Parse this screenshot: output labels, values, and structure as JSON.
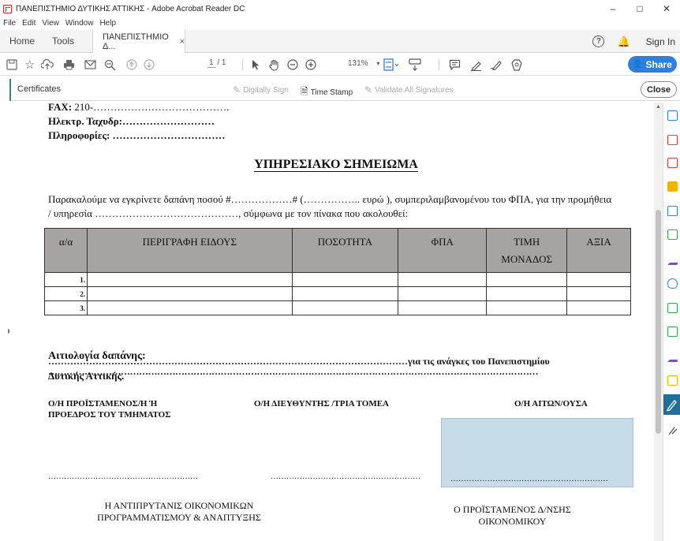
{
  "window": {
    "title": "ΠΑΝΕΠΙΣΤΗΜΙΟ ΔΥΤΙΚΗΣ ΑΤΤΙΚΗΣ - Adobe Acrobat Reader DC",
    "minimize": "–",
    "maximize": "□",
    "close": "✕"
  },
  "menu": [
    "File",
    "Edit",
    "View",
    "Window",
    "Help"
  ],
  "tabs": {
    "home": "Home",
    "tools": "Tools",
    "document": "ΠΑΝΕΠΙΣΤΗΜΙΟ Δ...",
    "document_close": "×",
    "help": "?",
    "sign_in": "Sign In"
  },
  "toolbar": {
    "page_current": "1",
    "page_total": "/ 1",
    "zoom": "131%",
    "share": "Share"
  },
  "certificates": {
    "title": "Certificates",
    "digitally_sign": "Digitally Sign",
    "time_stamp": "Time Stamp",
    "validate": "Validate All Signatures",
    "close": "Close"
  },
  "document": {
    "fax_label": "FAX:",
    "fax_value": " 210-………………………………….",
    "email_line": "Ηλεκτρ. Ταχυδρ:………………………",
    "info_line": "Πληροφορίες: ……………………………",
    "heading": "ΥΠΗΡΕΣΙΑΚΟ ΣΗΜΕΙΩΜΑ",
    "paragraph": "Παρακαλούμε να εγκρίνετε δαπάνη ποσού #………………# (…………….. ευρώ ), συμπεριλαμβανομένου του ΦΠΑ, για την προμήθεια / υπηρεσία ……………………………………, σύμφωνα με τον πίνακα που ακολουθεί:",
    "table": {
      "headers": [
        "α/α",
        "ΠΕΡΙΓΡΑΦΗ ΕΙΔΟΥΣ",
        "ΠΟΣΟΤΗΤΑ",
        "ΦΠΑ",
        "ΤΙΜΗ ΜΟΝΑΔΟΣ",
        "ΑΞΙΑ"
      ],
      "rows": [
        "1.",
        "2.",
        "3."
      ]
    },
    "justification_label": "Αιτιολογία δαπάνης:",
    "dots_line_1": "………………………………………………………………………………………………………………………………………………",
    "dots_line_2": "……………………………………………………………………………………………………για τις ανάγκες του Πανεπιστημίου",
    "dots_line_3": "Δυτικής Αττικής.",
    "sig_1": "Ο/Η ΠΡΟΪΣΤΑΜΕΝΟΣ/Η Ή ΠΡΟΕΔΡΟΣ ΤΟΥ ΤΜΗΜΑΤΟΣ",
    "sig_2": "Ο/Η ΔΙΕΥΘΥΝΤΗΣ /ΤΡΙΑ ΤΟΜΕΑ",
    "sig_3": "Ο/Η ΑΙΤΩΝ/ΟΥΣΑ",
    "sig_dots_1": "…………………………………………………",
    "sig_dots_2": "…………………………………………………",
    "sig_dots_3": "……………………………………………………",
    "footer_left": "Η ΑΝΤΙΠΡΥΤΑΝΙΣ ΟΙΚΟΝΟΜΙΚΩΝ ΠΡΟΓΡΑΜΜΑΤΙΣΜΟΥ & ΑΝΑΠΤΥΞΗΣ",
    "footer_right": "Ο ΠΡΟΪΣΤΑΜΕΝΟΣ Δ/ΝΣΗΣ ΟΙΚΟΝΟΜΙΚΟΥ"
  },
  "colors": {
    "share_button": "#2d7fe0",
    "table_header": "#a7a3a2",
    "signature_field": "#c7dce9",
    "active_tool": "#1f6f9a"
  }
}
